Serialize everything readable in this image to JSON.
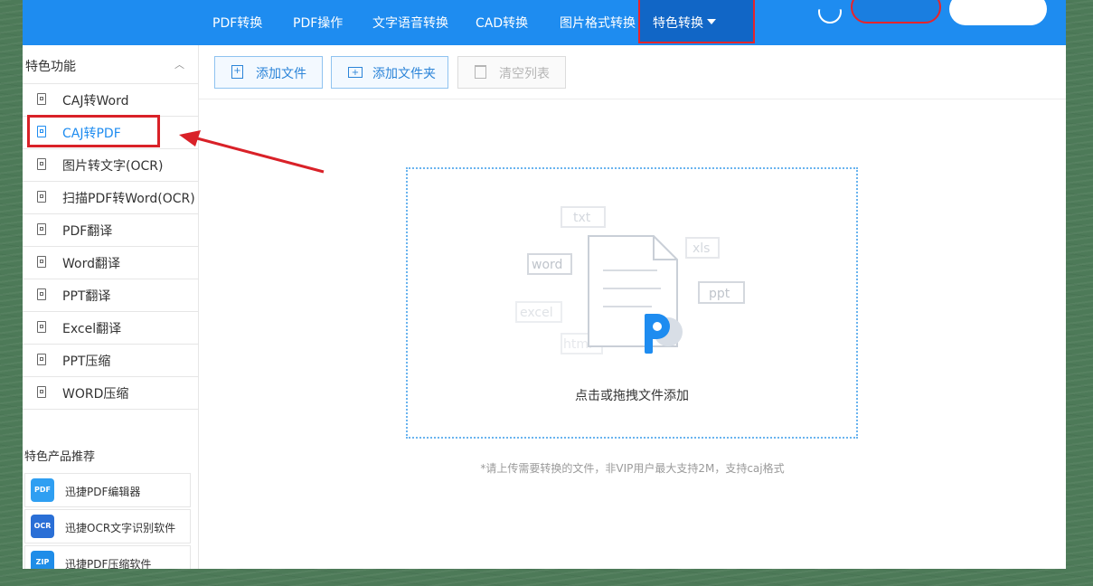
{
  "top_nav": {
    "items": [
      "PDF转换",
      "PDF操作",
      "文字语音转换",
      "CAD转换",
      "图片格式转换"
    ],
    "active": "特色转换"
  },
  "sidebar": {
    "section_title": "特色功能",
    "items": [
      {
        "label": "CAJ转Word"
      },
      {
        "label": "CAJ转PDF"
      },
      {
        "label": "图片转文字(OCR)"
      },
      {
        "label": "扫描PDF转Word(OCR)"
      },
      {
        "label": "PDF翻译"
      },
      {
        "label": "Word翻译"
      },
      {
        "label": "PPT翻译"
      },
      {
        "label": "Excel翻译"
      },
      {
        "label": "PPT压缩"
      },
      {
        "label": "WORD压缩"
      }
    ],
    "selected": "CAJ转PDF",
    "recommend_title": "特色产品推荐",
    "products": [
      {
        "label": "迅捷PDF编辑器",
        "icon": "pdf-editor-icon",
        "icon_text": "PDF"
      },
      {
        "label": "迅捷OCR文字识别软件",
        "icon": "ocr-icon",
        "icon_text": "OCR"
      },
      {
        "label": "迅捷PDF压缩软件",
        "icon": "zip-icon",
        "icon_text": "ZIP"
      }
    ]
  },
  "toolbar": {
    "add_file": "添加文件",
    "add_folder": "添加文件夹",
    "clear_list": "清空列表"
  },
  "dropzone": {
    "label": "点击或拖拽文件添加",
    "format_tags": [
      "txt",
      "word",
      "xls",
      "ppt",
      "excel",
      "html"
    ]
  },
  "hint": "*请上传需要转换的文件，非VIP用户最大支持2M，支持caj格式",
  "colors": {
    "brand": "#1e8cf0",
    "highlight": "#d92128",
    "background": "#4d7a58"
  }
}
